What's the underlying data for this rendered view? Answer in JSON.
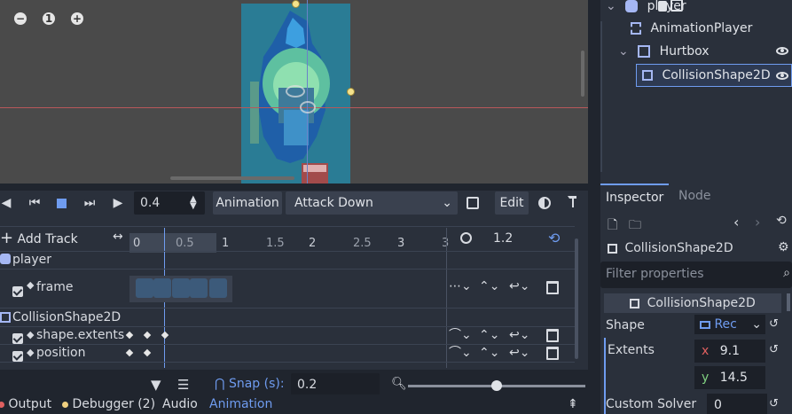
{
  "viewport": {
    "zoom_out": "−",
    "zoom_reset": "1",
    "zoom_in": "+"
  },
  "scene_tree": {
    "nodes": [
      {
        "label": "player"
      },
      {
        "label": "AnimationPlayer"
      },
      {
        "label": "Hurtbox"
      },
      {
        "label": "CollisionShape2D"
      }
    ]
  },
  "animation": {
    "time_value": "0.4",
    "animation_menu": "Animation",
    "selected_animation": "Attack Down",
    "edit_label": "Edit",
    "add_track_label": "Add Track",
    "ruler_ticks": [
      "0",
      "0.5",
      "1",
      "1.5",
      "2",
      "2.5",
      "3",
      "3"
    ],
    "length_value": "1.2",
    "tracks": [
      {
        "node": "player",
        "properties": [
          "frame"
        ]
      },
      {
        "node": "CollisionShape2D",
        "properties": [
          "shape.extents",
          "position"
        ]
      }
    ],
    "snap_label": "Snap (s):",
    "snap_value": "0.2"
  },
  "bottom_tabs": [
    "Output",
    "Debugger (2)",
    "Audio",
    "Animation"
  ],
  "inspector": {
    "tabs": [
      "Inspector",
      "Node"
    ],
    "object_name": "CollisionShape2D",
    "filter_placeholder": "Filter properties",
    "section_title": "CollisionShape2D",
    "shape_label": "Shape",
    "shape_value": "Rec",
    "extents_label": "Extents",
    "extents_x_label": "x",
    "extents_x": "9.1",
    "extents_y_label": "y",
    "extents_y": "14.5",
    "custom_solver_label": "Custom Solver",
    "custom_solver_value": "0"
  },
  "colors": {
    "accent": "#6f9cf0",
    "background": "#20252e",
    "panel": "#2a303b"
  }
}
